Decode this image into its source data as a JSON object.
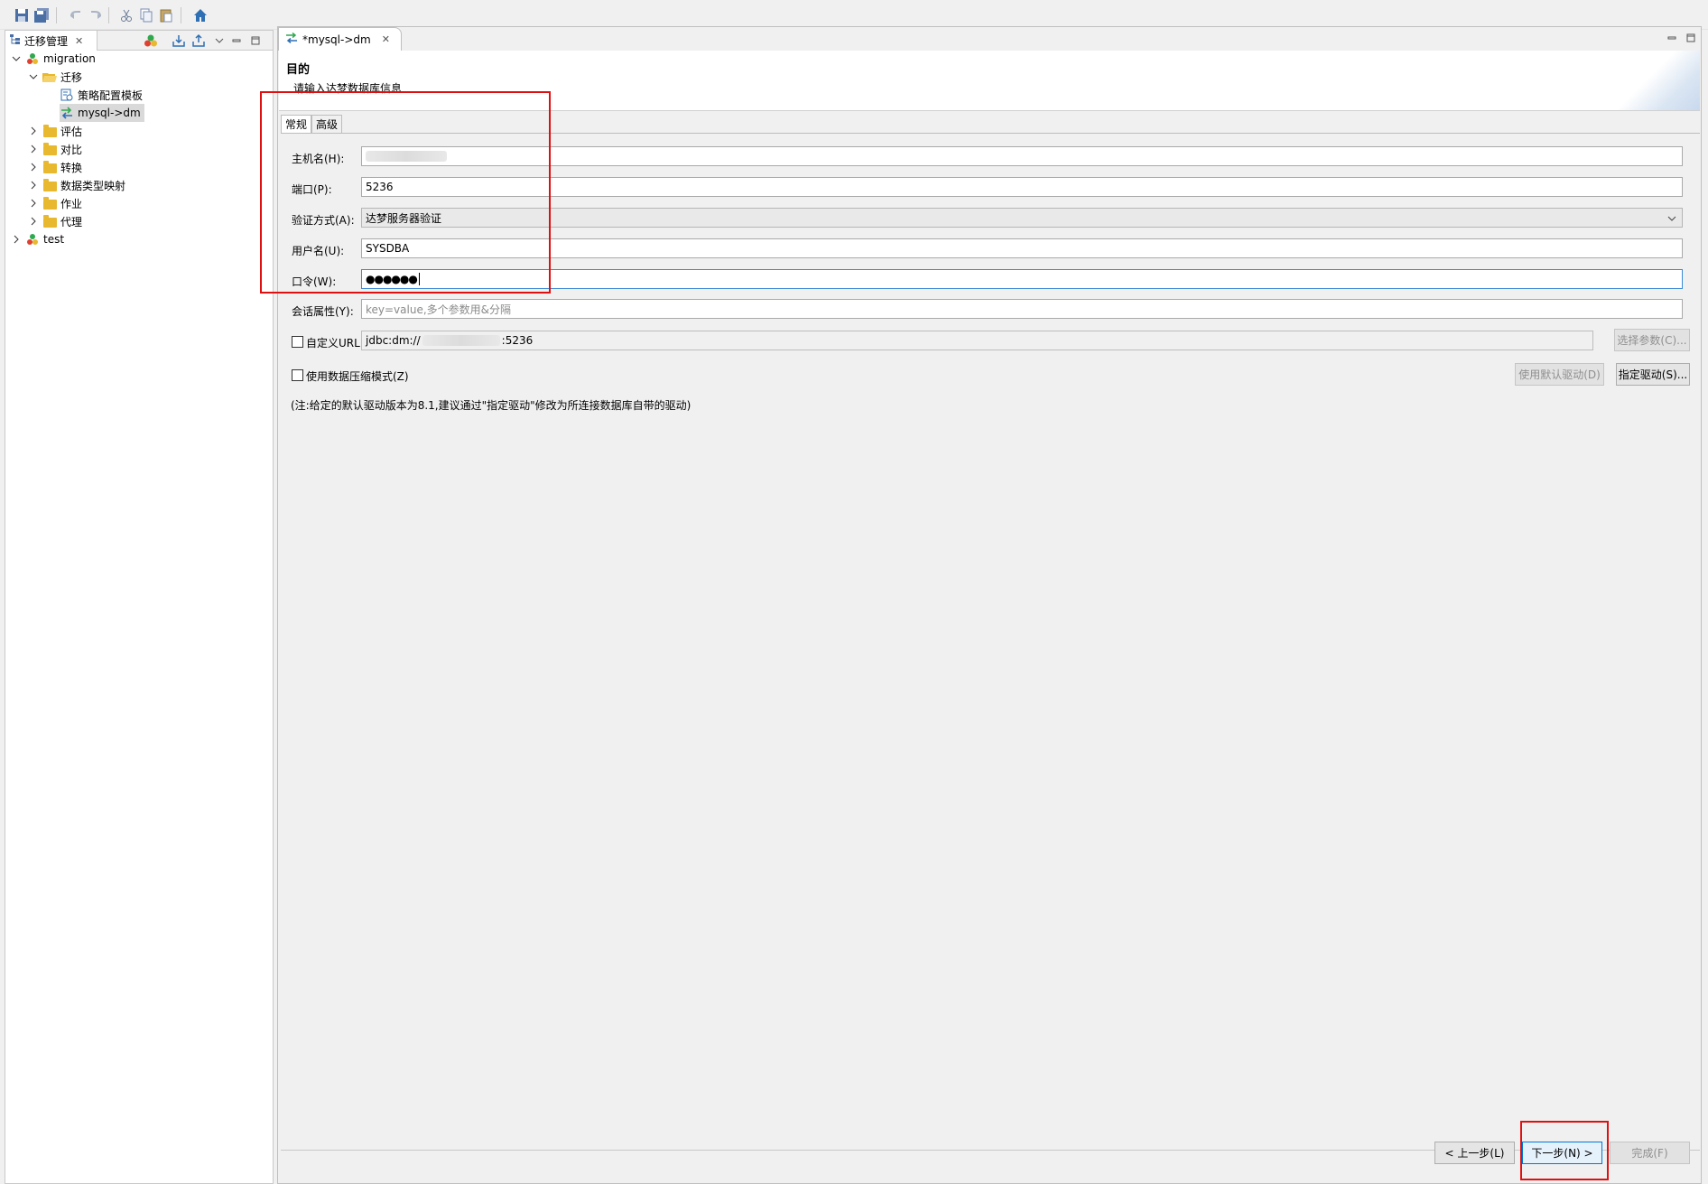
{
  "toolbar": {
    "icons": [
      "save-icon",
      "save-all-icon",
      "undo-icon",
      "redo-icon",
      "cut-icon",
      "copy-icon",
      "paste-icon",
      "home-icon"
    ]
  },
  "left_panel": {
    "tab_label": "迁移管理",
    "tree": [
      {
        "label": "migration",
        "level": 0,
        "expanded": true,
        "icon": "project-icon"
      },
      {
        "label": "迁移",
        "level": 1,
        "expanded": true,
        "icon": "folder-open-icon"
      },
      {
        "label": "策略配置模板",
        "level": 2,
        "icon": "template-icon"
      },
      {
        "label": "mysql->dm",
        "level": 2,
        "icon": "migration-icon",
        "selected": true
      },
      {
        "label": "评估",
        "level": 1,
        "icon": "folder-icon"
      },
      {
        "label": "对比",
        "level": 1,
        "icon": "folder-icon"
      },
      {
        "label": "转换",
        "level": 1,
        "icon": "folder-icon"
      },
      {
        "label": "数据类型映射",
        "level": 1,
        "icon": "folder-icon"
      },
      {
        "label": "作业",
        "level": 1,
        "icon": "folder-icon"
      },
      {
        "label": "代理",
        "level": 1,
        "icon": "folder-icon"
      },
      {
        "label": "test",
        "level": 0,
        "icon": "project-icon"
      }
    ]
  },
  "editor": {
    "tab_label": "*mysql->dm",
    "wizard_title": "目的",
    "wizard_subtitle": "请输入达梦数据库信息",
    "tabs": [
      "常规",
      "高级"
    ],
    "fields": {
      "host_label": "主机名(H):",
      "host_value": "",
      "port_label": "端口(P):",
      "port_value": "5236",
      "auth_label": "验证方式(A):",
      "auth_value": "达梦服务器验证",
      "user_label": "用户名(U):",
      "user_value": "SYSDBA",
      "password_label": "口令(W):",
      "password_value": "●●●●●●",
      "session_label": "会话属性(Y):",
      "session_placeholder": "key=value,多个参数用&分隔",
      "custom_url_label": "自定义URL:",
      "url_prefix": "jdbc:dm://",
      "url_suffix": ":5236",
      "select_params_button": "选择参数(C)...",
      "compress_label": "使用数据压缩模式(Z)",
      "default_driver_button": "使用默认驱动(D)",
      "specify_driver_button": "指定驱动(S)...",
      "note": "(注:给定的默认驱动版本为8.1,建议通过\"指定驱动\"修改为所连接数据库自带的驱动)"
    },
    "buttons": {
      "back": "< 上一步(L)",
      "next": "下一步(N) >",
      "finish": "完成(F)"
    }
  },
  "colors": {
    "highlight_box": "#e01010",
    "focus_border": "#3c8ad6",
    "primary_button_border": "#0078d7"
  }
}
